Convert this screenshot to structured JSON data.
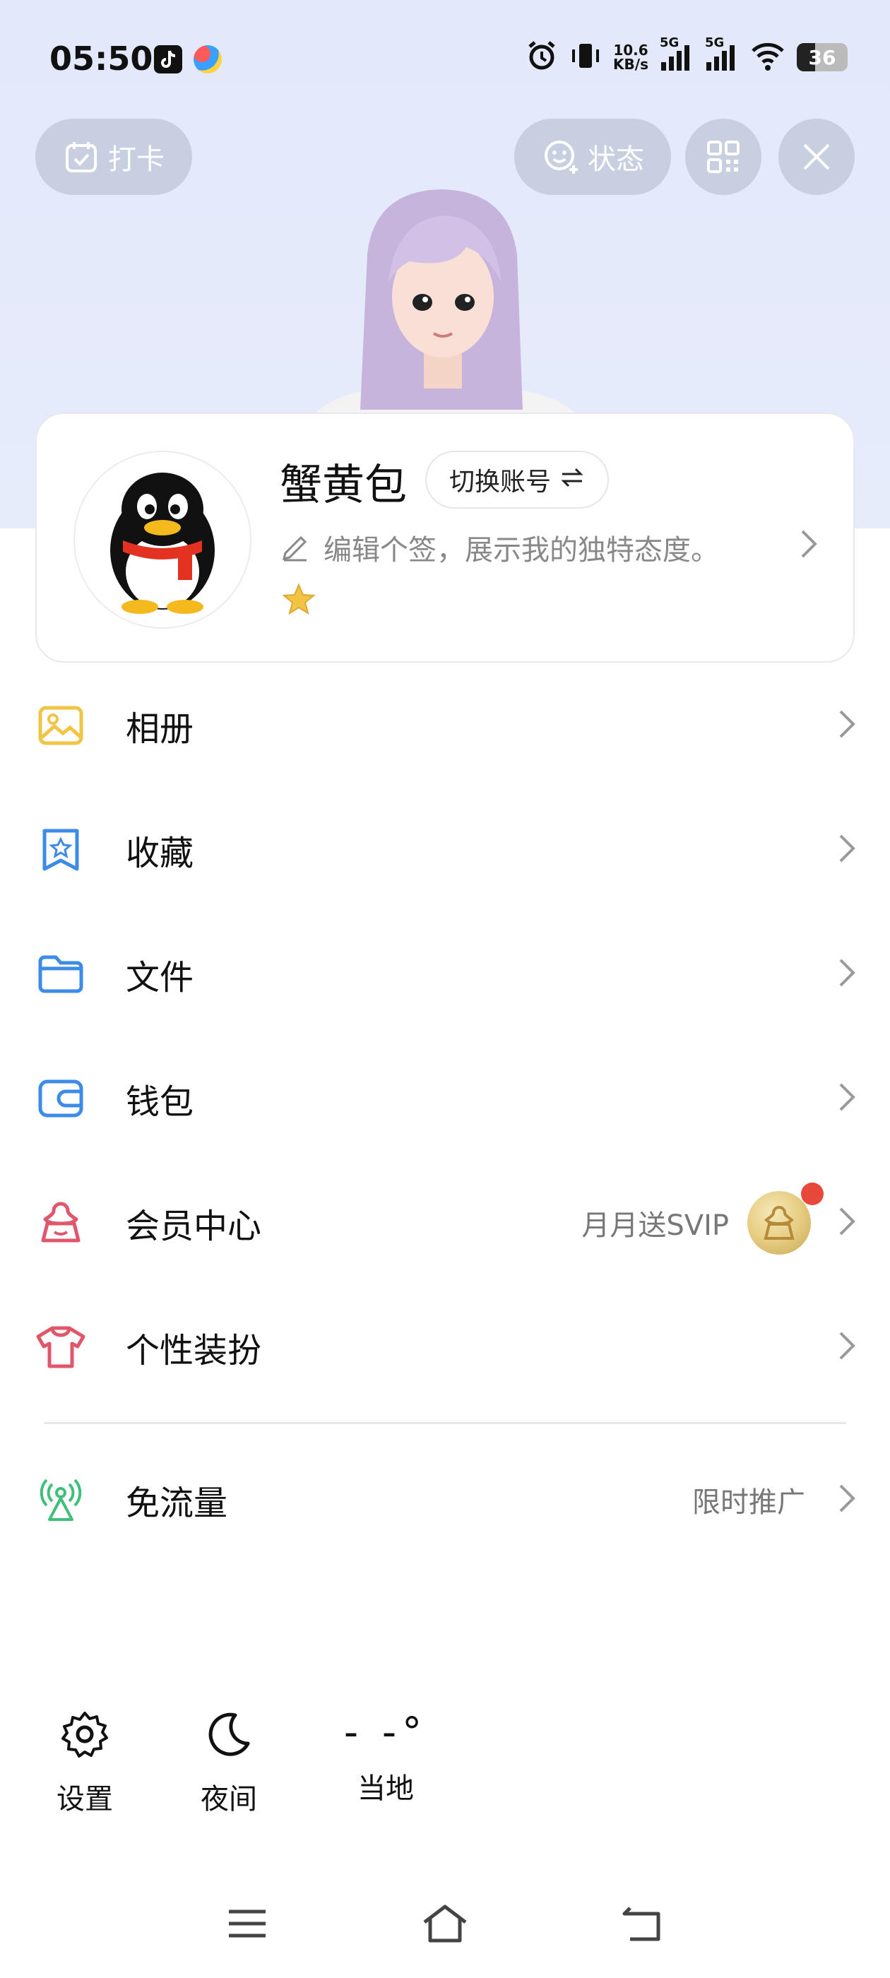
{
  "status_bar": {
    "time": "05:50",
    "net_speed_value": "10.6",
    "net_speed_unit": "KB/s",
    "sim1": "5G",
    "sim2": "5G",
    "battery": "36",
    "battery_level": 0.36
  },
  "header": {
    "checkin_label": "打卡",
    "status_label": "状态"
  },
  "profile": {
    "nickname": "蟹黄包",
    "switch_account_label": "切换账号",
    "signature_placeholder": "编辑个签，展示我的独特态度。"
  },
  "menu": {
    "album": "相册",
    "favorites": "收藏",
    "files": "文件",
    "wallet": "钱包",
    "vip_center": "会员中心",
    "vip_promo": "月月送SVIP",
    "personalization": "个性装扮",
    "free_data": "免流量",
    "free_data_promo": "限时推广"
  },
  "bottom_tools": {
    "settings": "设置",
    "night": "夜间",
    "weather_temp": "- -°",
    "weather_place": "当地"
  },
  "colors": {
    "hero_bg": "#e3e8fb",
    "album_icon": "#f2c443",
    "blue_icon": "#3d8be8",
    "vip_icon": "#e0566a",
    "free_data_icon": "#3fc07a",
    "notification_dot": "#e8483a"
  }
}
